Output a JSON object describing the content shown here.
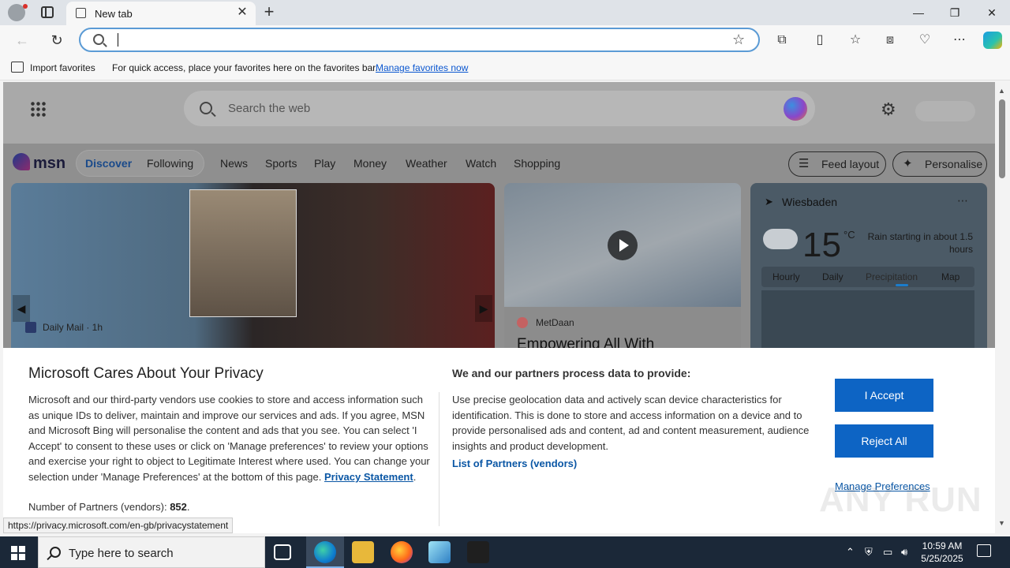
{
  "browser": {
    "tab_title": "New tab",
    "address_value": "",
    "favorites_bar": {
      "import_label": "Import favorites",
      "message": "For quick access, place your favorites here on the favorites bar.",
      "manage_link": "Manage favorites now"
    }
  },
  "msn": {
    "search_placeholder": "Search the web",
    "logo_text": "msn",
    "nav": {
      "discover": "Discover",
      "following": "Following",
      "items": [
        "News",
        "Sports",
        "Play",
        "Money",
        "Weather",
        "Watch",
        "Shopping"
      ]
    },
    "feed_layout": "Feed layout",
    "personalise": "Personalise",
    "hero": {
      "source": "Daily Mail · 1h"
    },
    "card2": {
      "source": "MetDaan",
      "headline": "Empowering All With"
    },
    "weather": {
      "location": "Wiesbaden",
      "temp": "15",
      "unit": "°C",
      "condition": "Rain starting in about 1.5 hours",
      "tabs": [
        "Hourly",
        "Daily",
        "Precipitation",
        "Map"
      ]
    }
  },
  "privacy": {
    "title": "Microsoft Cares About Your Privacy",
    "body": "Microsoft and our third-party vendors use cookies to store and access information such as unique IDs to deliver, maintain and improve our services and ads. If you agree, MSN and Microsoft Bing will personalise the content and ads that you see. You can select 'I Accept' to consent to these uses or click on 'Manage preferences' to review your options and exercise your right to object to Legitimate Interest where used.  You can change your selection under 'Manage Preferences' at the bottom of this page.",
    "statement_link": "Privacy Statement",
    "partners_label": "Number of Partners (vendors):",
    "partners_count": "852",
    "right_heading": "We and our partners process data to provide:",
    "right_body": "Use precise geolocation data and actively scan device characteristics for identification. This is done to store and access information on a device and to provide personalised ads and content, ad and content measurement, audience insights and product development.",
    "list_partners": "List of Partners (vendors)",
    "accept": "I Accept",
    "reject": "Reject All",
    "manage": "Manage Preferences"
  },
  "status_url": "https://privacy.microsoft.com/en-gb/privacystatement",
  "taskbar": {
    "search_placeholder": "Type here to search",
    "time": "10:59 AM",
    "date": "5/25/2025"
  },
  "watermark": "ANY RUN"
}
